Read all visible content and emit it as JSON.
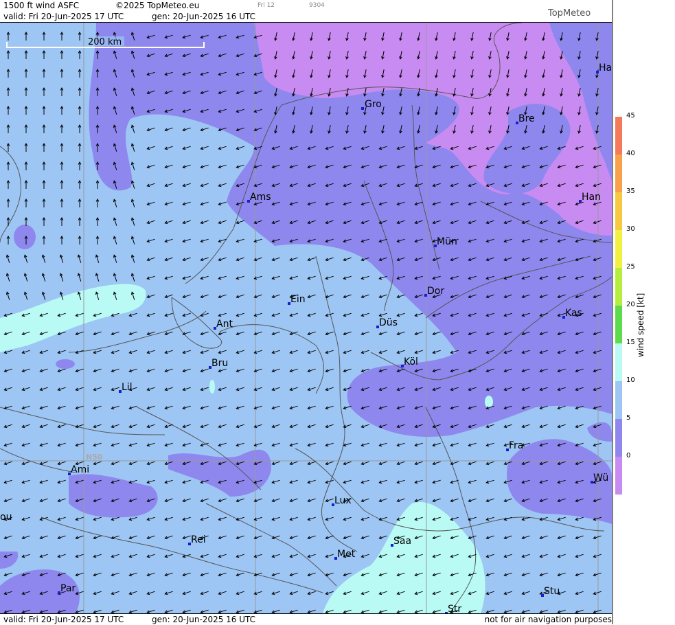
{
  "header": {
    "product": "1500 ft wind ASFC",
    "copyright": "©2025 TopMeteo.eu",
    "day_label": "Fri 12",
    "code": "9304",
    "valid": "valid:  Fri  20-Jun-2025  17 UTC",
    "gen": "gen: 20-Jun-2025 16 UTC",
    "brand": "TopMeteo"
  },
  "footer": {
    "valid": "valid:  Fri  20-Jun-2025  17 UTC",
    "gen": "gen: 20-Jun-2025 16 UTC",
    "disclaimer": "not for air navigation purposes"
  },
  "map": {
    "scale_label": "200 km",
    "lat_label": "N50",
    "cities": [
      {
        "name": "Ha"
      },
      {
        "name": "Gro"
      },
      {
        "name": "Bre"
      },
      {
        "name": "Ams"
      },
      {
        "name": "Han"
      },
      {
        "name": "Mün"
      },
      {
        "name": "Ein"
      },
      {
        "name": "Dor"
      },
      {
        "name": "Kas"
      },
      {
        "name": "Ant"
      },
      {
        "name": "Düs"
      },
      {
        "name": "Bru"
      },
      {
        "name": "Köl"
      },
      {
        "name": "Lil"
      },
      {
        "name": "Fra"
      },
      {
        "name": "Ami"
      },
      {
        "name": "Wü"
      },
      {
        "name": "ou"
      },
      {
        "name": "Lux"
      },
      {
        "name": "Rei"
      },
      {
        "name": "Saa"
      },
      {
        "name": "Met"
      },
      {
        "name": "Par"
      },
      {
        "name": "Stu"
      },
      {
        "name": "Str"
      }
    ]
  },
  "legend": {
    "title": "wind speed [kt]",
    "ticks": [
      "45",
      "40",
      "35",
      "30",
      "25",
      "20",
      "15",
      "10",
      "5",
      "0"
    ],
    "colors": [
      "#f47a5a",
      "#f9a04a",
      "#f8c840",
      "#f2f040",
      "#b6ee3e",
      "#5cdc4c",
      "#b9fbf4",
      "#9dc6f4",
      "#8e88ee",
      "#c88bf2"
    ]
  }
}
